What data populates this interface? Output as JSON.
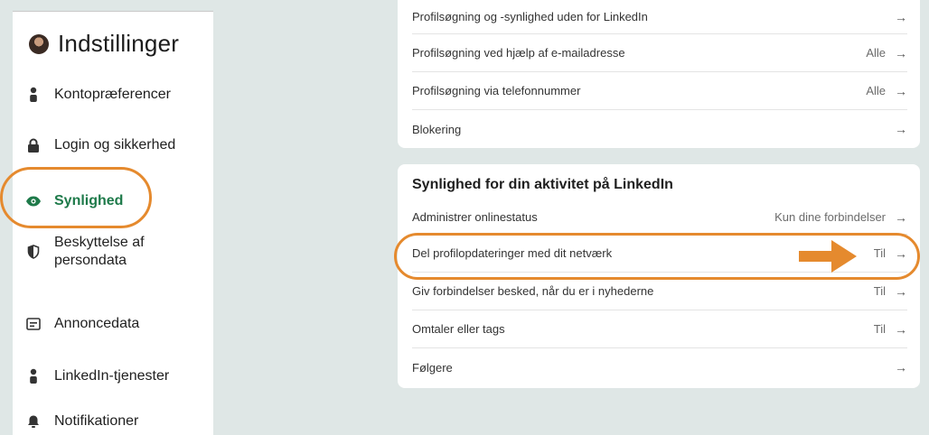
{
  "sidebar": {
    "title": "Indstillinger",
    "items": [
      {
        "label": "Kontopræferencer",
        "icon": "person-icon"
      },
      {
        "label": "Login og sikkerhed",
        "icon": "lock-icon"
      },
      {
        "label": "Synlighed",
        "icon": "eye-icon",
        "active": true
      },
      {
        "label": "Beskyttelse af persondata",
        "line1": "Beskyttelse af",
        "line2": "persondata",
        "icon": "shield-icon"
      },
      {
        "label": "Annoncedata",
        "icon": "ad-icon"
      },
      {
        "label": "LinkedIn-tjenester",
        "icon": "person-icon"
      },
      {
        "label": "Notifikationer",
        "icon": "bell-icon"
      }
    ]
  },
  "profile_panel": {
    "rows": [
      {
        "label": "Profilsøgning og -synlighed uden for LinkedIn",
        "value": ""
      },
      {
        "label": "Profilsøgning ved hjælp af e-mailadresse",
        "value": "Alle"
      },
      {
        "label": "Profilsøgning via telefonnummer",
        "value": "Alle"
      },
      {
        "label": "Blokering",
        "value": ""
      }
    ]
  },
  "activity_panel": {
    "title": "Synlighed for din aktivitet på LinkedIn",
    "rows": [
      {
        "label": "Administrer onlinestatus",
        "value": "Kun dine forbindelser"
      },
      {
        "label": "Del profilopdateringer med dit netværk",
        "value": "Til"
      },
      {
        "label": "Giv forbindelser besked, når du er i nyhederne",
        "value": "Til"
      },
      {
        "label": "Omtaler eller tags",
        "value": "Til"
      },
      {
        "label": "Følgere",
        "value": ""
      }
    ]
  },
  "colors": {
    "accent_orange": "#e58a2e",
    "active_green": "#1e7a4a",
    "background": "#dfe7e6"
  }
}
